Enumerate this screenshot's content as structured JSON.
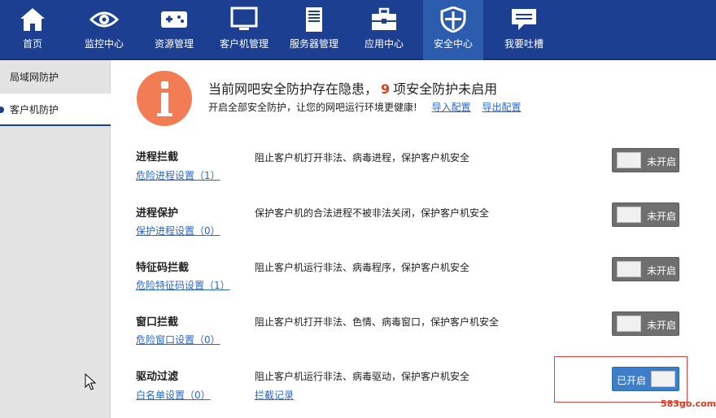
{
  "nav": {
    "items": [
      {
        "label": "首页",
        "icon": "home-icon"
      },
      {
        "label": "监控中心",
        "icon": "eye-icon"
      },
      {
        "label": "资源管理",
        "icon": "gamepad-icon"
      },
      {
        "label": "客户机管理",
        "icon": "monitor-icon"
      },
      {
        "label": "服务器管理",
        "icon": "server-icon"
      },
      {
        "label": "应用中心",
        "icon": "toolbox-icon"
      },
      {
        "label": "安全中心",
        "icon": "shield-icon",
        "active": true
      },
      {
        "label": "我要吐槽",
        "icon": "chat-icon"
      }
    ]
  },
  "sidebar": {
    "items": [
      {
        "label": "局域网防护"
      },
      {
        "label": "客户机防护",
        "selected": true
      }
    ]
  },
  "alert": {
    "prefix": "当前网吧安全防护存在隐患，",
    "count": "9",
    "suffix": "项安全防护未启用",
    "subtitle": "开启全部安全防护，让您的网吧运行环境更健康!",
    "import_link": "导入配置",
    "export_link": "导出配置"
  },
  "settings": [
    {
      "title": "进程拦截",
      "link": "危险进程设置（1）",
      "desc": "阻止客户机打开非法、病毒进程，保护客户机安全",
      "status": "未开启",
      "enabled": false
    },
    {
      "title": "进程保护",
      "link": "保护进程设置（0）",
      "desc": "保护客户机的合法进程不被非法关闭，保护客户机安全",
      "status": "未开启",
      "enabled": false
    },
    {
      "title": "特征码拦截",
      "link": "危险特征码设置（1）",
      "desc": "阻止客户机运行非法、病毒程序，保护客户机安全",
      "status": "未开启",
      "enabled": false
    },
    {
      "title": "窗口拦截",
      "link": "危险窗口设置（0）",
      "desc": "阻止客户机打开非法、色情、病毒窗口，保护客户机安全",
      "status": "未开启",
      "enabled": false
    },
    {
      "title": "驱动过滤",
      "link": "白名单设置（0）",
      "desc": "阻止客户机运行非法、病毒驱动，保护客户机安全",
      "extra_link": "拦截记录",
      "status": "已开启",
      "enabled": true
    }
  ],
  "watermark": "583go.com",
  "colors": {
    "nav_bg": "#1c3f91",
    "nav_active": "#2b5cad",
    "alert_icon": "#f27d55",
    "count": "#e23c1c",
    "link": "#2a66c4",
    "toggle_off": "#6f6f6f",
    "toggle_on": "#3c7ec9",
    "highlight_border": "#e04040"
  }
}
